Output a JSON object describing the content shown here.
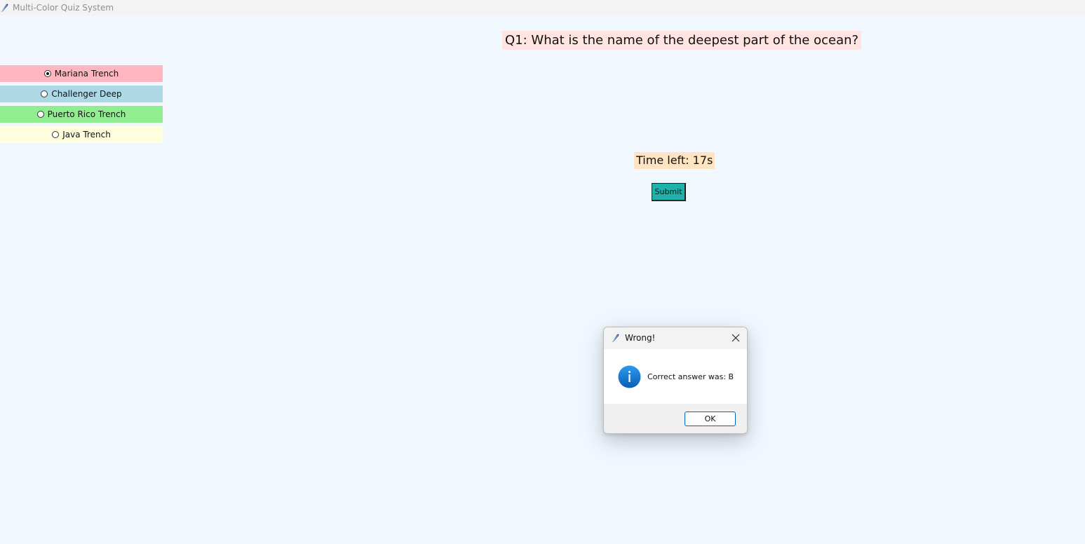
{
  "window": {
    "title": "Multi-Color Quiz System",
    "icon": "feather-icon",
    "background": "#f0f7ff"
  },
  "quiz": {
    "question": "Q1: What is the name of the deepest part of the ocean?",
    "question_bg": "#ffe4e1",
    "options": [
      {
        "label": "Mariana Trench",
        "color": "#ffb6c1",
        "selected": true
      },
      {
        "label": "Challenger Deep",
        "color": "#add8e6",
        "selected": false
      },
      {
        "label": "Puerto Rico Trench",
        "color": "#90ee90",
        "selected": false
      },
      {
        "label": "Java Trench",
        "color": "#ffffe0",
        "selected": false
      }
    ],
    "timer": "Time left: 17s",
    "timer_bg": "#ffe4c4",
    "submit_label": "Submit",
    "submit_bg": "#20b2aa"
  },
  "dialog": {
    "title": "Wrong!",
    "icon": "info-icon",
    "message": "Correct answer was: B",
    "ok_label": "OK"
  }
}
